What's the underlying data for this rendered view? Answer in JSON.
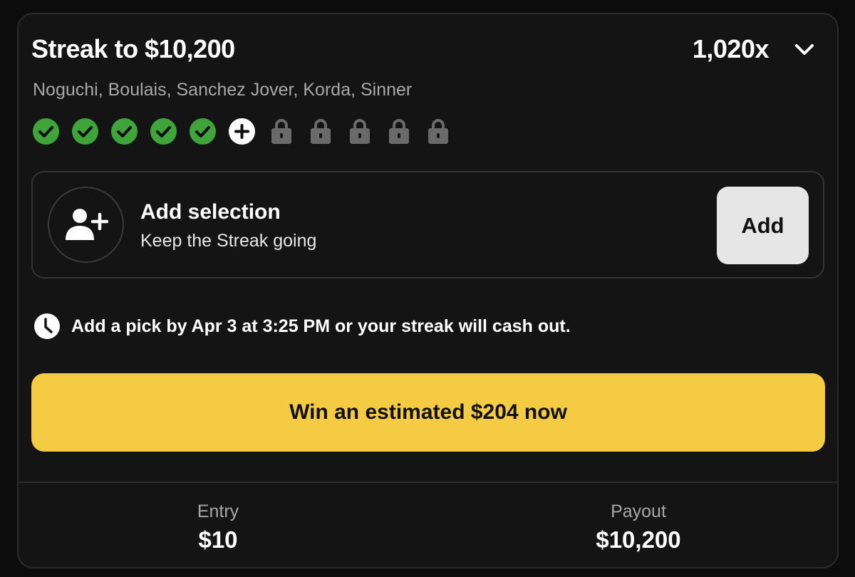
{
  "header": {
    "title": "Streak to $10,200",
    "multiplier": "1,020x",
    "chevron_icon": "chevron-down-icon"
  },
  "players": "Noguchi, Boulais, Sanchez Jover, Korda, Sinner",
  "streak": {
    "completed": 5,
    "current": 1,
    "locked": 5,
    "completed_color": "#3fa43a",
    "locked_color": "#6a6a6a"
  },
  "selection": {
    "title": "Add selection",
    "subtitle": "Keep the Streak going",
    "icon": "add-user-icon",
    "button_label": "Add"
  },
  "deadline": {
    "icon": "clock-icon",
    "text": "Add a pick by Apr 3 at 3:25 PM or your streak will cash out."
  },
  "cashout": {
    "label": "Win an estimated $204 now",
    "color": "#f5cb44"
  },
  "stats": {
    "entry_label": "Entry",
    "entry_value": "$10",
    "payout_label": "Payout",
    "payout_value": "$10,200"
  }
}
